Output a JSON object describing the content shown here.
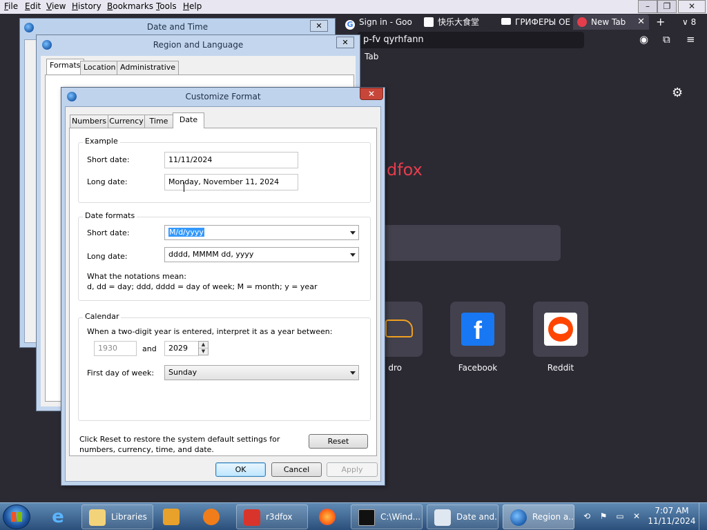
{
  "browser": {
    "menu": [
      "File",
      "Edit",
      "View",
      "History",
      "Bookmarks",
      "Tools",
      "Help"
    ],
    "tabs": [
      {
        "label": "Sign in - Goo"
      },
      {
        "label": "快乐大食堂"
      },
      {
        "label": "ГРИФЕРЫ ОЕ"
      },
      {
        "label": "New Tab"
      }
    ],
    "tab_count": "8",
    "url_text": "p-fv qyrhfann",
    "bookmark_text": "Tab",
    "logo_fragment": "dfox",
    "shortcuts": [
      {
        "label": "dro"
      },
      {
        "label": "Facebook"
      },
      {
        "label": "Reddit"
      }
    ]
  },
  "dialogs": {
    "date_time": {
      "title": "Date and Time"
    },
    "region_language": {
      "title": "Region and Language",
      "tabs": [
        "Formats",
        "Location",
        "Administrative"
      ]
    }
  },
  "customize_format": {
    "title": "Customize Format",
    "tabs": [
      "Numbers",
      "Currency",
      "Time",
      "Date"
    ],
    "selected_tab": "Date",
    "example": {
      "title": "Example",
      "short_label": "Short date:",
      "short_value": "11/11/2024",
      "long_label": "Long date:",
      "long_value": "Monday, November 11, 2024"
    },
    "date_formats": {
      "title": "Date formats",
      "short_label": "Short date:",
      "short_value": "M/d/yyyy",
      "long_label": "Long date:",
      "long_value": "dddd, MMMM dd, yyyy",
      "notation_title": "What the notations mean:",
      "notation_text": "d, dd = day;  ddd, dddd = day of week;  M = month;  y = year"
    },
    "calendar": {
      "title": "Calendar",
      "two_digit_text": "When a two-digit year is entered, interpret it as a year between:",
      "year_from": "1930",
      "and_label": "and",
      "year_to": "2029",
      "first_day_label": "First day of week:",
      "first_day_value": "Sunday"
    },
    "reset_text_1": "Click Reset to restore the system default settings for",
    "reset_text_2": "numbers, currency, time, and date.",
    "buttons": {
      "reset": "Reset",
      "ok": "OK",
      "cancel": "Cancel",
      "apply": "Apply"
    }
  },
  "taskbar": {
    "items": [
      {
        "label": "Libraries"
      },
      {
        "label": "r3dfox"
      },
      {
        "label": "C:\\Wind..."
      },
      {
        "label": "Date and..."
      },
      {
        "label": "Region a..."
      }
    ],
    "time": "7:07 AM",
    "date": "11/11/2024"
  }
}
